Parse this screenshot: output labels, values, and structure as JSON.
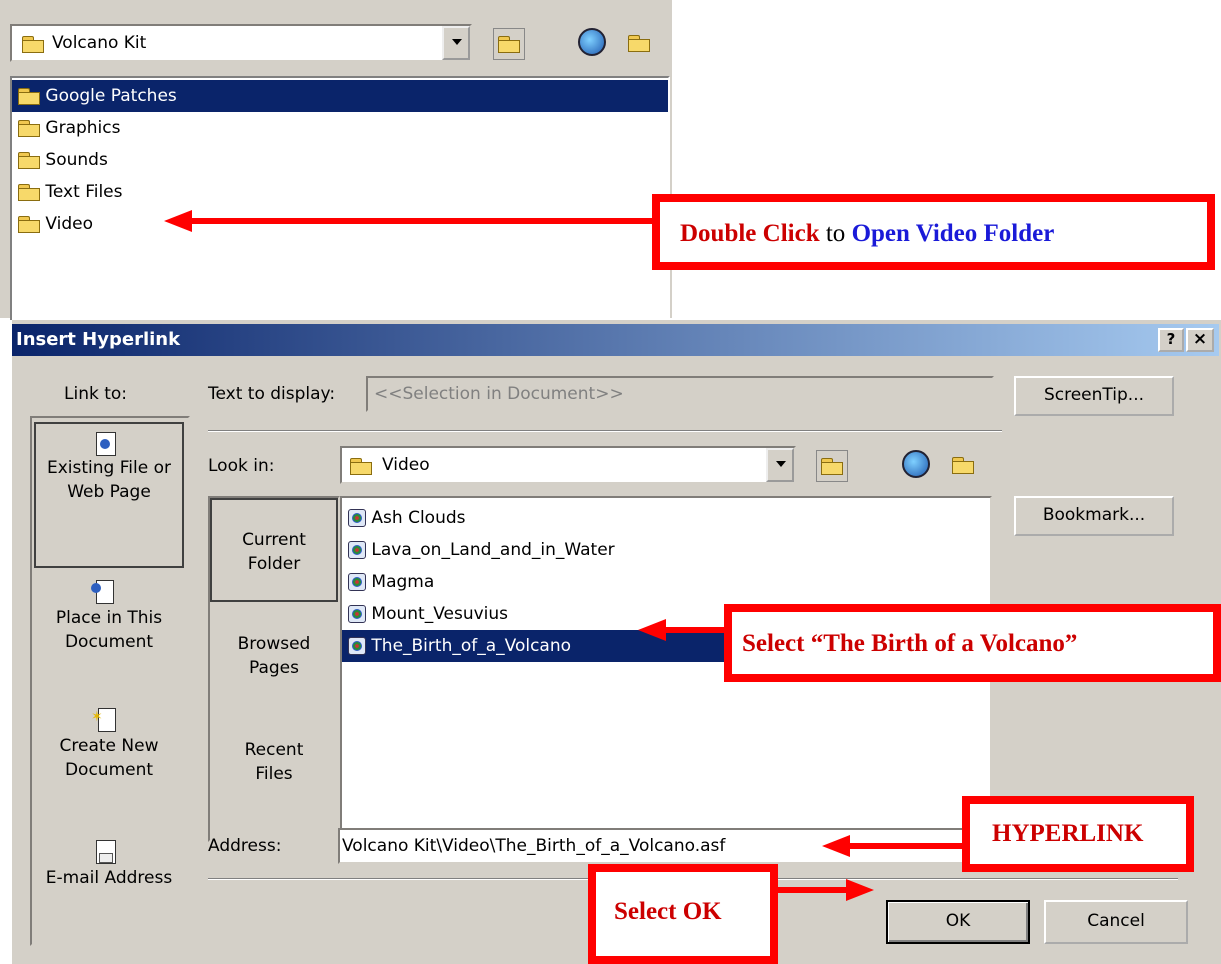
{
  "top_dialog": {
    "lookin_value": "Volcano Kit",
    "items": [
      {
        "label": "Google Patches",
        "selected": true
      },
      {
        "label": "Graphics",
        "selected": false
      },
      {
        "label": "Sounds",
        "selected": false
      },
      {
        "label": "Text Files",
        "selected": false
      },
      {
        "label": "Video",
        "selected": false
      }
    ]
  },
  "dialog": {
    "title": "Insert Hyperlink",
    "help_btn": "?",
    "close_btn": "×",
    "link_to_label": "Link to:",
    "text_to_display_label": "Text to display:",
    "text_to_display_value": "<<Selection in Document>>",
    "screentip_btn": "ScreenTip...",
    "look_in_label": "Look in:",
    "look_in_value": "Video",
    "bookmark_btn": "Bookmark...",
    "address_label": "Address:",
    "address_value": "Volcano Kit\\Video\\The_Birth_of_a_Volcano.asf",
    "ok_btn": "OK",
    "cancel_btn": "Cancel",
    "link_to_items": [
      {
        "line1": "Existing File or",
        "line2": "Web Page",
        "selected": true
      },
      {
        "line1": "Place in This",
        "line2": "Document",
        "selected": false
      },
      {
        "line1": "Create New",
        "line2": "Document",
        "selected": false
      },
      {
        "line1": "E-mail Address",
        "line2": "",
        "selected": false
      }
    ],
    "browse_items": [
      {
        "line1": "Current",
        "line2": "Folder",
        "selected": true
      },
      {
        "line1": "Browsed",
        "line2": "Pages",
        "selected": false
      },
      {
        "line1": "Recent",
        "line2": "Files",
        "selected": false
      }
    ],
    "files": [
      {
        "label": "Ash Clouds",
        "selected": false
      },
      {
        "label": "Lava_on_Land_and_in_Water",
        "selected": false
      },
      {
        "label": "Magma",
        "selected": false
      },
      {
        "label": "Mount_Vesuvius",
        "selected": false
      },
      {
        "label": "The_Birth_of_a_Volcano",
        "selected": true
      }
    ]
  },
  "annotations": {
    "double_click_red": "Double Click",
    "double_click_mid": " to ",
    "double_click_blue": "Open Video Folder",
    "select_birth": "Select “The Birth of a Volcano”",
    "hyperlink": "HYPERLINK",
    "select_ok": "Select OK"
  },
  "colors": {
    "title_bar_start": "#0a246a",
    "title_bar_end": "#a6caf0",
    "dialog_face": "#d4d0c8",
    "selection": "#0a246a",
    "annotation_red": "#ff0000",
    "annotation_text_red": "#cc0000",
    "annotation_text_blue": "#1a1ad8"
  }
}
